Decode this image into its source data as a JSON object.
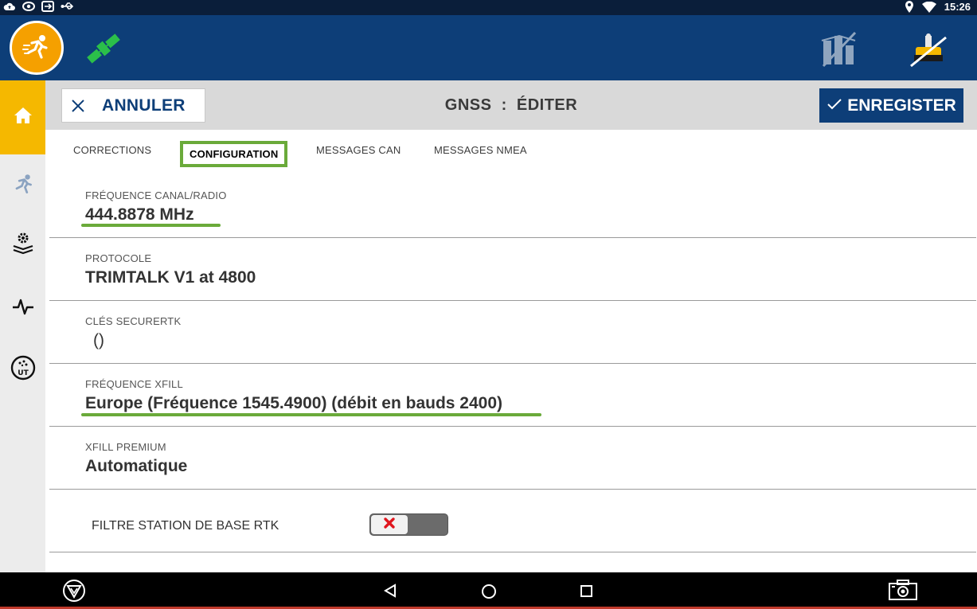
{
  "status_bar": {
    "time": "15:26",
    "left_icons": [
      "cloud-upload-icon",
      "eye-icon",
      "remote-icon",
      "usb-icon"
    ],
    "right_icons": [
      "location-icon",
      "wifi-icon"
    ]
  },
  "app_header": {
    "left_icons": [
      "running-man-icon",
      "satellite-icon"
    ],
    "right_icons": [
      "implement-disabled-icon",
      "receiver-disabled-icon"
    ],
    "accent_color": "#f5a000",
    "bar_color": "#0d3e78"
  },
  "sidebar": {
    "items": [
      {
        "icon": "home-icon",
        "active": true
      },
      {
        "icon": "run-icon",
        "active": false
      },
      {
        "icon": "field-settings-icon",
        "active": false
      },
      {
        "icon": "diagnostics-icon",
        "active": false
      },
      {
        "icon": "ut-icon",
        "active": false
      }
    ],
    "active_color": "#f5b800"
  },
  "toolbar": {
    "cancel_label": "ANNULER",
    "title": "GNSS  :  ÉDITER",
    "save_label": "ENREGISTER"
  },
  "tabs": [
    {
      "label": "CORRECTIONS",
      "active": false
    },
    {
      "label": "CONFIGURATION",
      "active": true
    },
    {
      "label": "MESSAGES CAN",
      "active": false
    },
    {
      "label": "MESSAGES NMEA",
      "active": false
    }
  ],
  "fields": [
    {
      "label": "FRÉQUENCE CANAL/RADIO",
      "value": "444.8878 MHz"
    },
    {
      "label": "PROTOCOLE",
      "value": "TRIMTALK V1 at 4800"
    },
    {
      "label": "CLÉS SECURERTK",
      "value": "()"
    },
    {
      "label": "FRÉQUENCE XFILL",
      "value": "Europe (Fréquence 1545.4900) (débit en bauds 2400)"
    },
    {
      "label": "XFILL PREMIUM",
      "value": "Automatique"
    }
  ],
  "toggle_row": {
    "label": "FILTRE STATION DE BASE RTK",
    "enabled": false
  },
  "highlight_color": "#6aaa3a",
  "nav_bar": {
    "buttons": [
      "trimble-icon",
      "back-icon",
      "home-circle-icon",
      "recents-icon",
      "screenshot-icon"
    ]
  }
}
